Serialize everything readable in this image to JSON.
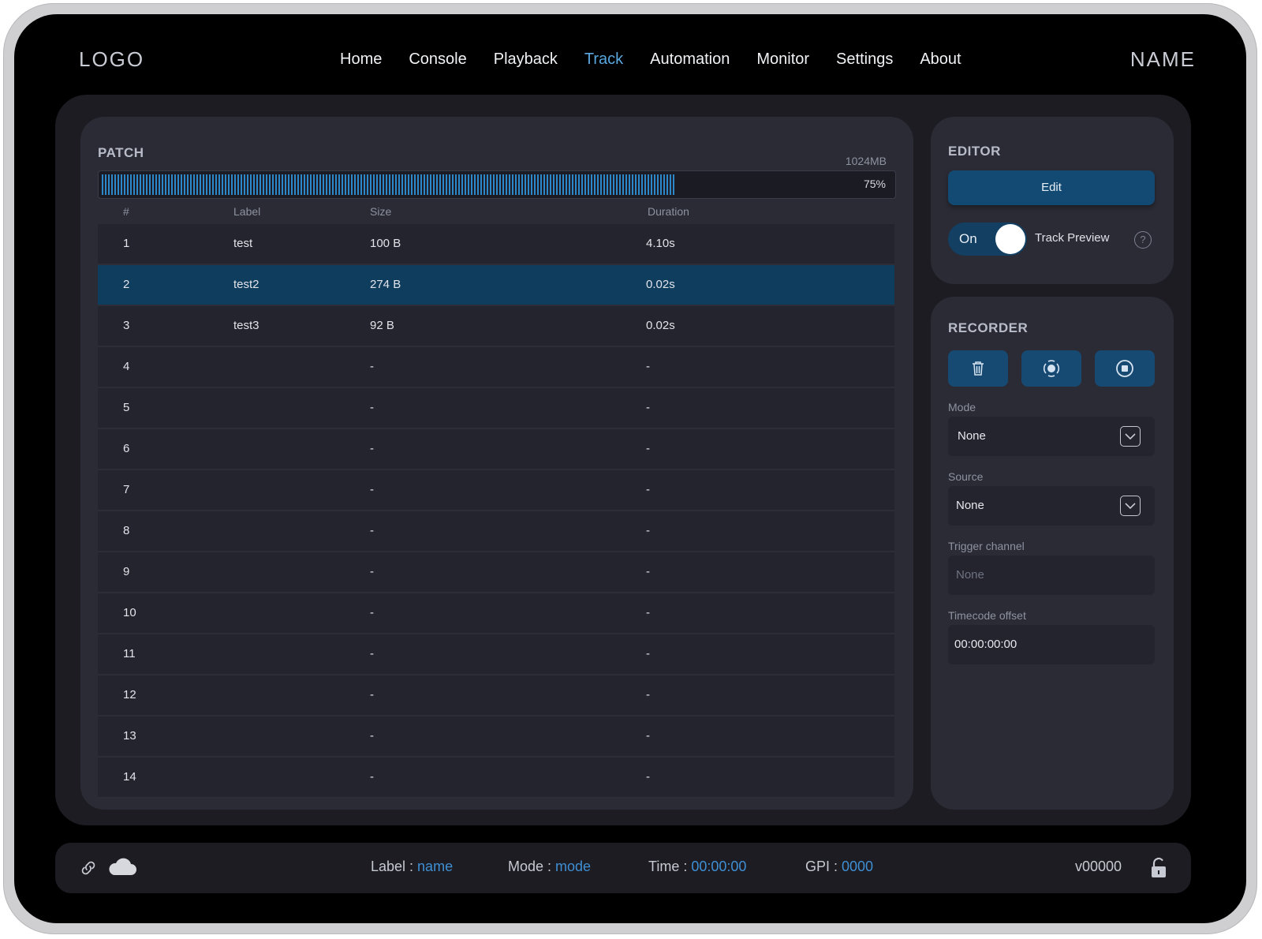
{
  "header": {
    "logo": "LOGO",
    "name": "NAME",
    "nav": [
      "Home",
      "Console",
      "Playback",
      "Track",
      "Automation",
      "Monitor",
      "Settings",
      "About"
    ],
    "active_nav": "Track"
  },
  "patch": {
    "title": "PATCH",
    "memory_total": "1024MB",
    "memory_used_percent": 75,
    "memory_label": "75%",
    "columns": [
      "#",
      "Label",
      "Size",
      "Duration"
    ],
    "selected_row": 2,
    "rows": [
      {
        "num": "1",
        "label": "test",
        "size": "100 B",
        "duration": "4.10s"
      },
      {
        "num": "2",
        "label": "test2",
        "size": "274 B",
        "duration": "0.02s"
      },
      {
        "num": "3",
        "label": "test3",
        "size": "92 B",
        "duration": "0.02s"
      },
      {
        "num": "4",
        "label": "",
        "size": "-",
        "duration": "-"
      },
      {
        "num": "5",
        "label": "",
        "size": "-",
        "duration": "-"
      },
      {
        "num": "6",
        "label": "",
        "size": "-",
        "duration": "-"
      },
      {
        "num": "7",
        "label": "",
        "size": "-",
        "duration": "-"
      },
      {
        "num": "8",
        "label": "",
        "size": "-",
        "duration": "-"
      },
      {
        "num": "9",
        "label": "",
        "size": "-",
        "duration": "-"
      },
      {
        "num": "10",
        "label": "",
        "size": "-",
        "duration": "-"
      },
      {
        "num": "11",
        "label": "",
        "size": "-",
        "duration": "-"
      },
      {
        "num": "12",
        "label": "",
        "size": "-",
        "duration": "-"
      },
      {
        "num": "13",
        "label": "",
        "size": "-",
        "duration": "-"
      },
      {
        "num": "14",
        "label": "",
        "size": "-",
        "duration": "-"
      }
    ]
  },
  "editor": {
    "title": "EDITOR",
    "edit_label": "Edit",
    "toggle_label": "On",
    "toggle_on": true,
    "preview_label": "Track Preview",
    "help": "?"
  },
  "recorder": {
    "title": "RECORDER",
    "buttons": [
      "trash-icon",
      "capture-icon",
      "stop-icon"
    ],
    "mode_label": "Mode",
    "mode_value": "None",
    "source_label": "Source",
    "source_value": "None",
    "trigger_label": "Trigger channel",
    "trigger_placeholder": "None",
    "timecode_label": "Timecode offset",
    "timecode_value": "00:00:00:00"
  },
  "footer": {
    "label_key": "Label : ",
    "label_val": "name",
    "mode_key": "Mode : ",
    "mode_val": "mode",
    "time_key": "Time : ",
    "time_val": "00:00:00",
    "gpi_key": "GPI : ",
    "gpi_val": "0000",
    "version": "v00000",
    "accent": "#3f8fd4"
  }
}
